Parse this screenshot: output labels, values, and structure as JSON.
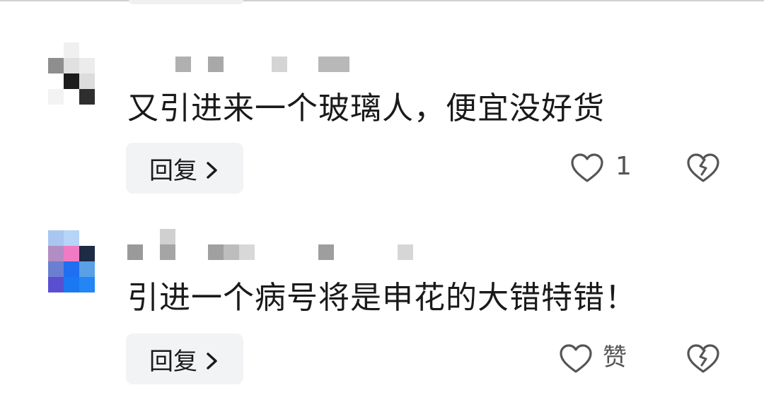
{
  "comments": [
    {
      "text": "又引进来一个玻璃人，便宜没好货",
      "reply_label": "回复",
      "like_text": "1",
      "icons": {
        "chevron": "chevron-right-icon",
        "like": "heart-outline-icon",
        "dislike": "broken-heart-icon"
      }
    },
    {
      "text": "引进一个病号将是申花的大错特错！",
      "reply_label": "回复",
      "like_text": "赞",
      "icons": {
        "chevron": "chevron-right-icon",
        "like": "heart-outline-icon",
        "dislike": "broken-heart-icon"
      }
    }
  ],
  "colors": {
    "text": "#1a1a1a",
    "button_bg": "#f2f3f5",
    "icon": "#555555"
  }
}
